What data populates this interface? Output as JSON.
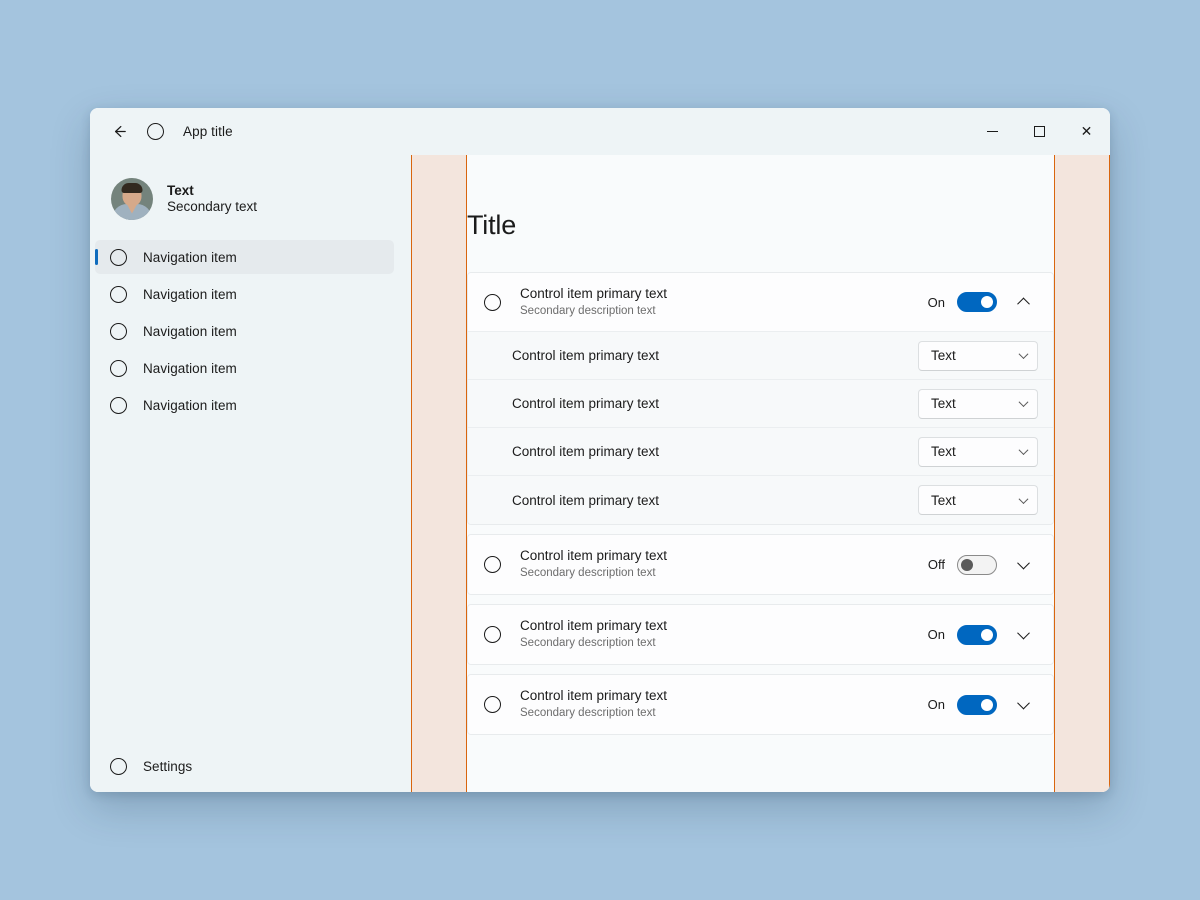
{
  "window": {
    "title_bar": {
      "back_label": "←",
      "back_icon": "arrow-left-icon",
      "app_icon": "app-icon-circle",
      "app_title": "App title",
      "minimize_label": "–",
      "maximize_label": "□",
      "close_label": "✕"
    }
  },
  "sidebar": {
    "profile": {
      "primary": "Text",
      "secondary": "Secondary text"
    },
    "nav_items": [
      {
        "label": "Navigation item",
        "selected": true
      },
      {
        "label": "Navigation item",
        "selected": false
      },
      {
        "label": "Navigation item",
        "selected": false
      },
      {
        "label": "Navigation item",
        "selected": false
      },
      {
        "label": "Navigation item",
        "selected": false
      }
    ],
    "settings": {
      "label": "Settings"
    }
  },
  "content": {
    "page_title": "Title",
    "groups": [
      {
        "header": {
          "primary": "Control item primary text",
          "secondary": "Secondary description text",
          "toggle_state": "On",
          "toggle_on": true,
          "expanded": true
        },
        "sub_rows": [
          {
            "label": "Control item primary text",
            "dropdown_value": "Text"
          },
          {
            "label": "Control item primary text",
            "dropdown_value": "Text"
          },
          {
            "label": "Control item primary text",
            "dropdown_value": "Text"
          },
          {
            "label": "Control item primary text",
            "dropdown_value": "Text"
          }
        ]
      },
      {
        "header": {
          "primary": "Control item primary text",
          "secondary": "Secondary description text",
          "toggle_state": "Off",
          "toggle_on": false,
          "expanded": false
        },
        "sub_rows": []
      },
      {
        "header": {
          "primary": "Control item primary text",
          "secondary": "Secondary description text",
          "toggle_state": "On",
          "toggle_on": true,
          "expanded": false
        },
        "sub_rows": []
      },
      {
        "header": {
          "primary": "Control item primary text",
          "secondary": "Secondary description text",
          "toggle_state": "On",
          "toggle_on": true,
          "expanded": false
        },
        "sub_rows": []
      }
    ]
  },
  "colors": {
    "desktop_background": "#a4c4de",
    "titlebar_background": "#eef4f6",
    "sidebar_background": "#eef4f6",
    "content_background": "#f9fbfc",
    "card_background": "#fdfdfe",
    "accent_blue": "#0067c0",
    "nav_indicator_blue": "#0f6cbd",
    "margin_guide_fill": "#f3e5dd",
    "margin_guide_line": "#d9650d",
    "text_primary": "#1b1b1b",
    "text_secondary": "#6d6d6d"
  }
}
